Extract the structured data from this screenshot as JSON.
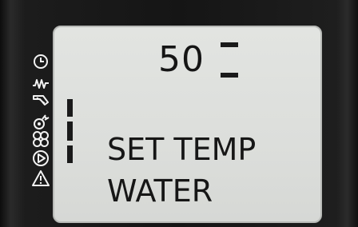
{
  "display": {
    "value": "50",
    "message_line1": "SET TEMP",
    "message_line2": "WATER"
  },
  "icons": [
    "clock-icon",
    "heater-wave-icon",
    "water-tap-icon",
    "bell-alarm-icon",
    "fan-icon",
    "play-icon",
    "warning-icon"
  ],
  "colors": {
    "bezel": "#151515",
    "lcd_background": "#dcdedb",
    "segment": "#1a1a1a",
    "icon": "#f2f2f2"
  }
}
